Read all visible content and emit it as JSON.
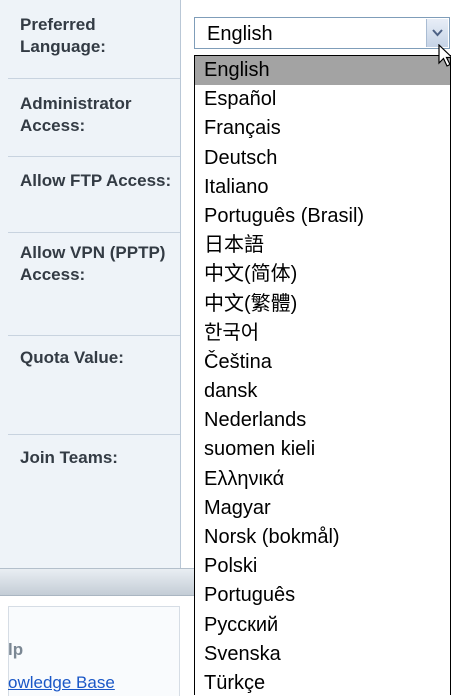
{
  "form": {
    "fields": [
      {
        "label": "Preferred Language:"
      },
      {
        "label": "Administrator Access:"
      },
      {
        "label": "Allow FTP Access:"
      },
      {
        "label": "Allow VPN (PPTP) Access:"
      },
      {
        "label": "Quota Value:"
      },
      {
        "label": "Join Teams:"
      }
    ]
  },
  "language_select": {
    "selected": "English",
    "arrow_icon": "chevron-down-icon",
    "options": [
      "English",
      "Español",
      "Français",
      "Deutsch",
      "Italiano",
      "Português (Brasil)",
      "日本語",
      "中文(简体)",
      "中文(繁體)",
      "한국어",
      "Čeština",
      "dansk",
      "Nederlands",
      "suomen kieli",
      "Ελληνικά",
      "Magyar",
      "Norsk (bokmål)",
      "Polski",
      "Português",
      "Русский",
      "Svenska",
      "Türkçe"
    ],
    "highlighted_index": 0
  },
  "help": {
    "title": "lp",
    "link": "owledge Base"
  },
  "colors": {
    "label_bg": "#eef3f8",
    "highlight": "#a3a3a3",
    "link": "#1a57c7"
  }
}
